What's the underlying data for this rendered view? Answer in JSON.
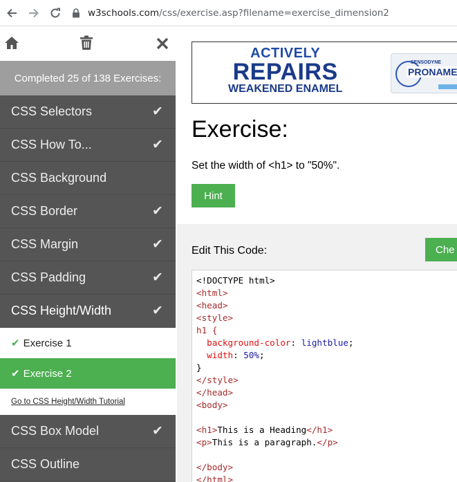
{
  "browser": {
    "url_host": "w3schools.com",
    "url_path": "/css/exercise.asp?filename=exercise_dimension2"
  },
  "sidebar": {
    "completed_text": "Completed 25 of 138 Exercises:",
    "items": [
      {
        "label": "CSS Selectors",
        "done": true
      },
      {
        "label": "CSS How To...",
        "done": true
      },
      {
        "label": "CSS Background",
        "done": false
      },
      {
        "label": "CSS Border",
        "done": true
      },
      {
        "label": "CSS Margin",
        "done": true
      },
      {
        "label": "CSS Padding",
        "done": true
      },
      {
        "label": "CSS Height/Width",
        "done": true
      }
    ],
    "sub_items": [
      {
        "label": "Exercise 1"
      },
      {
        "label": "Exercise 2"
      }
    ],
    "tutorial_link": "Go to CSS Height/Width Tutorial",
    "items_after": [
      {
        "label": "CSS Box Model",
        "done": true
      },
      {
        "label": "CSS Outline",
        "done": false
      }
    ],
    "check_glyph": "✔"
  },
  "ad": {
    "line1": "ACTIVELY",
    "line2": "REPAIRS",
    "line3": "WEAKENED ENAMEL",
    "brand": "SENSODYNE",
    "product": "PRONAMEL"
  },
  "main": {
    "title": "Exercise:",
    "instruction": "Set the width of <h1> to \"50%\".",
    "hint_label": "Hint",
    "edit_label": "Edit This Code:",
    "check_label": "Che"
  },
  "colors": {
    "accent": "#4caf50",
    "sidebar_bg": "#555555",
    "completed_bg": "#9e9e9e"
  }
}
